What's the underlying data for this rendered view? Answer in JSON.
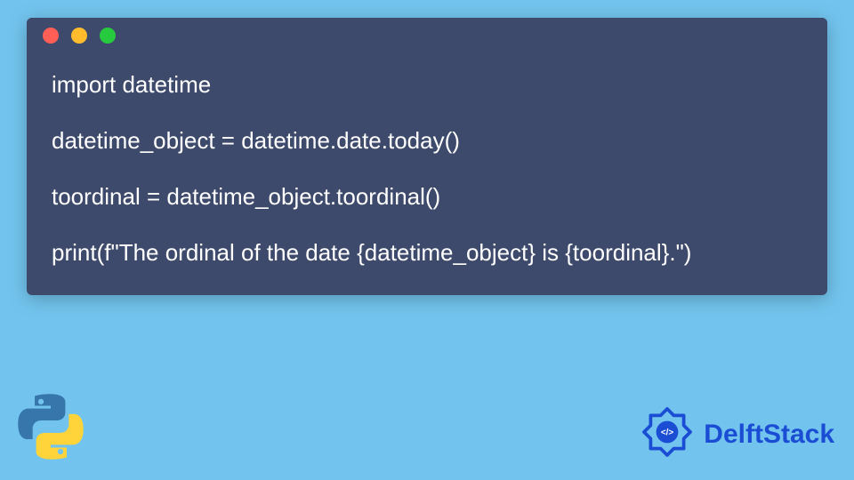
{
  "code": {
    "line1": "import datetime",
    "line2": "datetime_object = datetime.date.today()",
    "line3": "toordinal = datetime_object.toordinal()",
    "line4": "print(f\"The ordinal of the date {datetime_object} is {toordinal}.\")"
  },
  "brand": {
    "name": "DelftStack"
  },
  "colors": {
    "page_bg": "#72c4ee",
    "window_bg": "#3e4a6b",
    "dot_red": "#ff5f56",
    "dot_yellow": "#ffbd2e",
    "dot_green": "#27c93f",
    "brand_blue": "#1a4dd4",
    "python_blue": "#3776ab",
    "python_yellow": "#ffd43b"
  }
}
